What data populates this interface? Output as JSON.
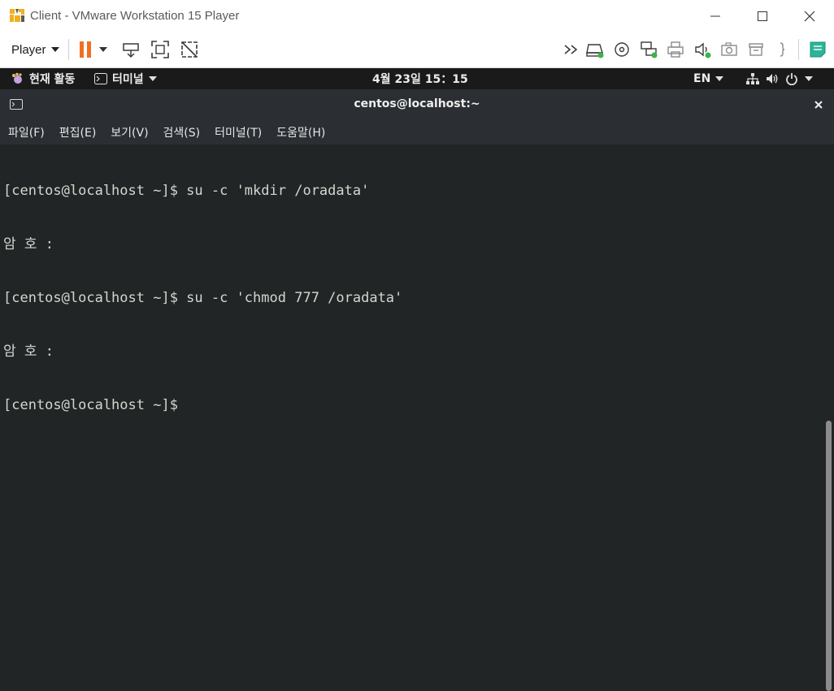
{
  "window": {
    "title": "Client - VMware Workstation 15 Player",
    "controls": [
      "minimize-icon",
      "maximize-icon",
      "close-icon"
    ]
  },
  "toolbar": {
    "player_label": "Player",
    "left_icons": [
      "pause-icon",
      "send-ctrl-alt-del-icon",
      "fullscreen-icon",
      "unity-icon"
    ],
    "right_icons": [
      "more-devices-icon",
      "hard-disk-icon",
      "cd-dvd-icon",
      "network-adapter-icon",
      "printer-icon",
      "sound-card-icon",
      "camera-icon",
      "usb-icon",
      "brackets-icon",
      "notes-icon"
    ],
    "accent_orange": "#f07022",
    "status_green": "#3cb34a"
  },
  "gnome": {
    "activities": "현재 활동",
    "app_menu": "터미널",
    "clock": "4월 23일  15：15",
    "input_method": "EN"
  },
  "terminal": {
    "title": "centos@localhost:~",
    "menu": [
      "파일(F)",
      "편집(E)",
      "보기(V)",
      "검색(S)",
      "터미널(T)",
      "도움말(H)"
    ],
    "lines": [
      "[centos@localhost ~]$ su -c 'mkdir /oradata'",
      "암 호 :",
      "[centos@localhost ~]$ su -c 'chmod 777 /oradata'",
      "암 호 :",
      "[centos@localhost ~]$"
    ],
    "background": "#212526",
    "foreground": "#d3d7cf"
  }
}
